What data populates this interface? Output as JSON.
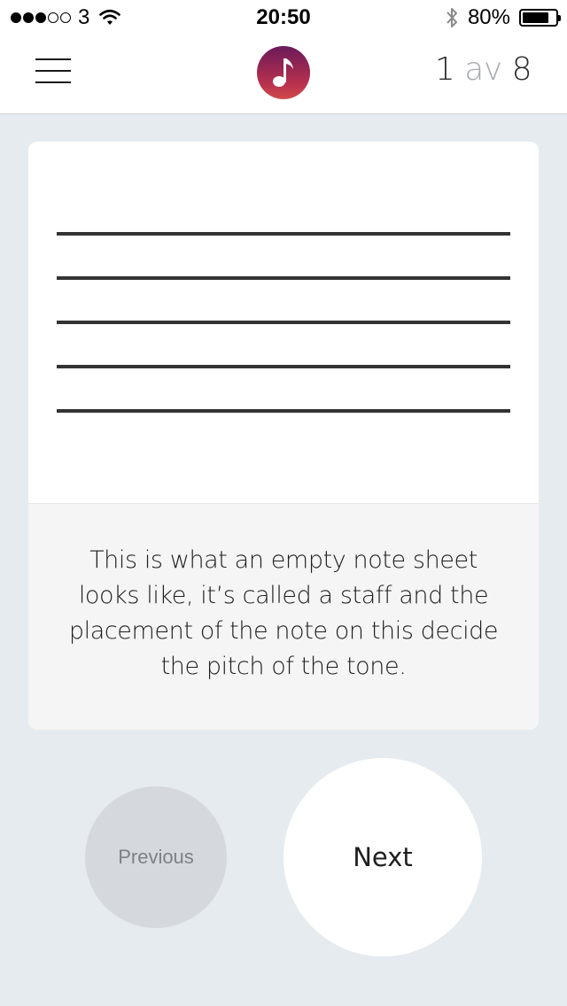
{
  "status_bar": {
    "carrier": "3",
    "signal_filled": 3,
    "signal_total": 5,
    "time": "20:50",
    "battery_text": "80%",
    "battery_level": 0.8,
    "icons": [
      "signal-dots",
      "wifi-icon",
      "bluetooth-icon",
      "battery-icon"
    ]
  },
  "header": {
    "menu_icon": "hamburger-menu-icon",
    "logo_icon": "music-note-icon",
    "logo_glyph": "♪",
    "page_current": "1",
    "page_separator": "av",
    "page_total": "8"
  },
  "lesson": {
    "staff_lines": 5,
    "caption": "This is what an empty note sheet looks like, it’s called a staff and the placement of the note on this decide the pitch of the tone."
  },
  "controls": {
    "previous_label": "Previous",
    "next_label": "Next"
  },
  "colors": {
    "background": "#e6ebf0",
    "logo_gradient_top": "#6a1a5a",
    "logo_gradient_bottom": "#d04a4a",
    "previous_button": "#d5d9de",
    "next_button": "#ffffff"
  }
}
